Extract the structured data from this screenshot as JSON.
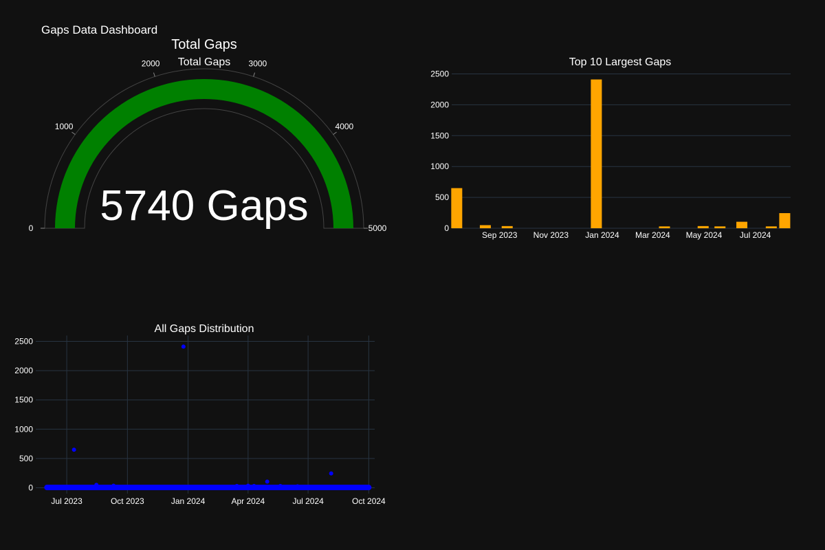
{
  "dashboard": {
    "title": "Gaps Data Dashboard"
  },
  "colors": {
    "background": "#111111",
    "gauge_bar": "#008000",
    "bar": "#FFA500",
    "scatter": "#0000FF",
    "grid": "#283442",
    "text": "#ffffff"
  },
  "chart_data": [
    {
      "type": "gauge",
      "title": "Total Gaps",
      "subtitle": "Total Gaps",
      "value": 5740,
      "value_suffix": " Gaps",
      "value_label": "5740 Gaps",
      "range": [
        0,
        5000
      ],
      "ticks": [
        0,
        1000,
        2000,
        3000,
        4000,
        5000
      ],
      "tick_labels": [
        "0",
        "1000",
        "2000",
        "3000",
        "4000",
        "5000"
      ]
    },
    {
      "type": "bar",
      "title": "Top 10 Largest Gaps",
      "x": [
        "2023-07-12",
        "2023-08-15",
        "2023-09-10",
        "2023-12-25",
        "2024-03-15",
        "2024-04-30",
        "2024-05-20",
        "2024-06-15",
        "2024-07-20",
        "2024-08-05"
      ],
      "values": [
        650,
        50,
        35,
        2410,
        30,
        35,
        30,
        105,
        30,
        245
      ],
      "ylim": [
        0,
        2550
      ],
      "yticks": [
        0,
        500,
        1000,
        1500,
        2000,
        2500
      ],
      "xticks": [
        "2023-09-01",
        "2023-11-01",
        "2024-01-01",
        "2024-03-01",
        "2024-05-01",
        "2024-07-01"
      ],
      "xtick_labels": [
        "Sep 2023",
        "Nov 2023",
        "Jan 2024",
        "Mar 2024",
        "May 2024",
        "Jul 2024"
      ],
      "xlim": [
        "2023-07-06",
        "2024-08-12"
      ],
      "grid": true
    },
    {
      "type": "scatter",
      "title": "All Gaps Distribution",
      "outliers": {
        "x": [
          "2023-07-12",
          "2023-08-15",
          "2023-09-10",
          "2023-12-25",
          "2024-03-15",
          "2024-04-01",
          "2024-04-10",
          "2024-04-30",
          "2024-08-05",
          "2024-05-20",
          "2024-06-15"
        ],
        "y": [
          650,
          50,
          35,
          2410,
          30,
          35,
          30,
          105,
          245,
          30,
          25
        ]
      },
      "baseline": {
        "x_start": "2023-06-01",
        "x_end": "2024-10-01",
        "y": 5
      },
      "ylim": [
        -100,
        2600
      ],
      "yticks": [
        0,
        500,
        1000,
        1500,
        2000,
        2500
      ],
      "xticks": [
        "2023-07-01",
        "2023-10-01",
        "2024-01-01",
        "2024-04-01",
        "2024-07-01",
        "2024-10-01"
      ],
      "xtick_labels": [
        "Jul 2023",
        "Oct 2023",
        "Jan 2024",
        "Apr 2024",
        "Jul 2024",
        "Oct 2024"
      ],
      "xlim": [
        "2023-05-15",
        "2024-10-10"
      ],
      "grid": true
    }
  ]
}
